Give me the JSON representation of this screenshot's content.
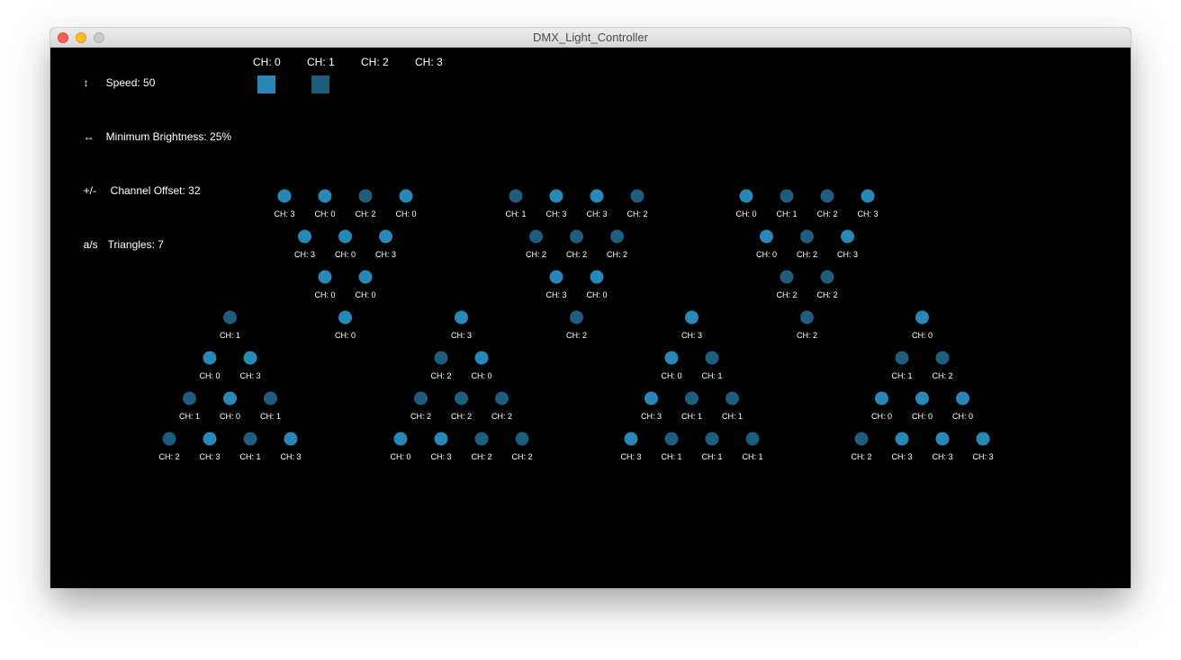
{
  "window": {
    "title": "DMX_Light_Controller",
    "controls": [
      "close-button",
      "minimize-button",
      "maximize-button"
    ]
  },
  "hud": {
    "speed": {
      "key": "↕",
      "text": "Speed: 50"
    },
    "brightness": {
      "key": "↔",
      "text": "Minimum Brightness: 25%"
    },
    "offset": {
      "key": "+/-",
      "text": "Channel Offset: 32"
    },
    "triangles": {
      "key": "a/s",
      "text": "Triangles: 7"
    }
  },
  "channels": [
    {
      "label": "CH: 0",
      "color": "#2889b8"
    },
    {
      "label": "CH: 1",
      "color": "#1e5d7e"
    },
    {
      "label": "CH: 2",
      "color": "#1e5d7e"
    },
    {
      "label": "CH: 3",
      "color": "#2889b8"
    }
  ],
  "light_label_prefix": "CH: ",
  "triangles": [
    {
      "orientation": "down",
      "rows": [
        [
          3,
          0,
          2,
          0
        ],
        [
          3,
          0,
          3
        ],
        [
          0,
          0
        ],
        [
          0
        ]
      ]
    },
    {
      "orientation": "down",
      "rows": [
        [
          1,
          3,
          3,
          2
        ],
        [
          2,
          2,
          2
        ],
        [
          3,
          0
        ],
        [
          2
        ]
      ]
    },
    {
      "orientation": "down",
      "rows": [
        [
          0,
          1,
          2,
          3
        ],
        [
          0,
          2,
          3
        ],
        [
          2,
          2
        ],
        [
          2
        ]
      ]
    },
    {
      "orientation": "up",
      "rows": [
        [
          1
        ],
        [
          0,
          3
        ],
        [
          1,
          0,
          1
        ],
        [
          2,
          3,
          1,
          3
        ]
      ]
    },
    {
      "orientation": "up",
      "rows": [
        [
          3
        ],
        [
          2,
          0
        ],
        [
          2,
          2,
          2
        ],
        [
          0,
          3,
          2,
          2
        ]
      ]
    },
    {
      "orientation": "up",
      "rows": [
        [
          3
        ],
        [
          0,
          1
        ],
        [
          3,
          1,
          1
        ],
        [
          3,
          1,
          1,
          1
        ]
      ]
    },
    {
      "orientation": "up",
      "rows": [
        [
          0
        ],
        [
          1,
          2
        ],
        [
          0,
          0,
          0
        ],
        [
          2,
          3,
          3,
          3
        ]
      ]
    }
  ]
}
